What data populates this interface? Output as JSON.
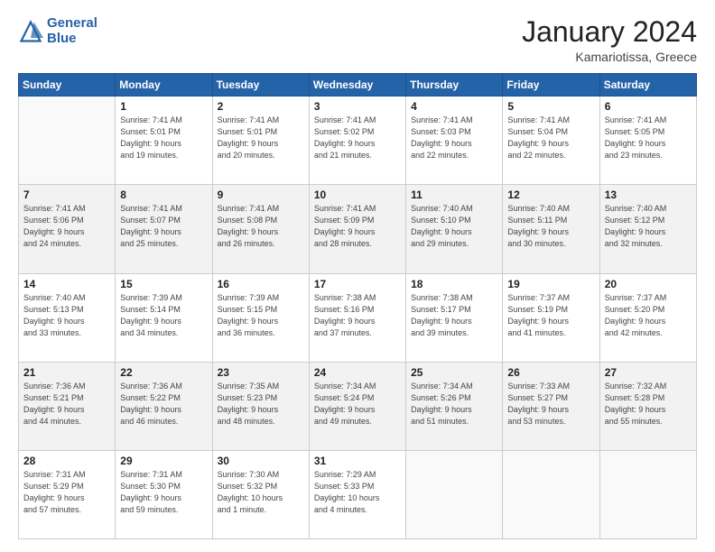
{
  "header": {
    "logo_line1": "General",
    "logo_line2": "Blue",
    "month": "January 2024",
    "location": "Kamariotissa, Greece"
  },
  "weekdays": [
    "Sunday",
    "Monday",
    "Tuesday",
    "Wednesday",
    "Thursday",
    "Friday",
    "Saturday"
  ],
  "weeks": [
    [
      {
        "day": "",
        "info": ""
      },
      {
        "day": "1",
        "info": "Sunrise: 7:41 AM\nSunset: 5:01 PM\nDaylight: 9 hours\nand 19 minutes."
      },
      {
        "day": "2",
        "info": "Sunrise: 7:41 AM\nSunset: 5:01 PM\nDaylight: 9 hours\nand 20 minutes."
      },
      {
        "day": "3",
        "info": "Sunrise: 7:41 AM\nSunset: 5:02 PM\nDaylight: 9 hours\nand 21 minutes."
      },
      {
        "day": "4",
        "info": "Sunrise: 7:41 AM\nSunset: 5:03 PM\nDaylight: 9 hours\nand 22 minutes."
      },
      {
        "day": "5",
        "info": "Sunrise: 7:41 AM\nSunset: 5:04 PM\nDaylight: 9 hours\nand 22 minutes."
      },
      {
        "day": "6",
        "info": "Sunrise: 7:41 AM\nSunset: 5:05 PM\nDaylight: 9 hours\nand 23 minutes."
      }
    ],
    [
      {
        "day": "7",
        "info": "Sunrise: 7:41 AM\nSunset: 5:06 PM\nDaylight: 9 hours\nand 24 minutes."
      },
      {
        "day": "8",
        "info": "Sunrise: 7:41 AM\nSunset: 5:07 PM\nDaylight: 9 hours\nand 25 minutes."
      },
      {
        "day": "9",
        "info": "Sunrise: 7:41 AM\nSunset: 5:08 PM\nDaylight: 9 hours\nand 26 minutes."
      },
      {
        "day": "10",
        "info": "Sunrise: 7:41 AM\nSunset: 5:09 PM\nDaylight: 9 hours\nand 28 minutes."
      },
      {
        "day": "11",
        "info": "Sunrise: 7:40 AM\nSunset: 5:10 PM\nDaylight: 9 hours\nand 29 minutes."
      },
      {
        "day": "12",
        "info": "Sunrise: 7:40 AM\nSunset: 5:11 PM\nDaylight: 9 hours\nand 30 minutes."
      },
      {
        "day": "13",
        "info": "Sunrise: 7:40 AM\nSunset: 5:12 PM\nDaylight: 9 hours\nand 32 minutes."
      }
    ],
    [
      {
        "day": "14",
        "info": "Sunrise: 7:40 AM\nSunset: 5:13 PM\nDaylight: 9 hours\nand 33 minutes."
      },
      {
        "day": "15",
        "info": "Sunrise: 7:39 AM\nSunset: 5:14 PM\nDaylight: 9 hours\nand 34 minutes."
      },
      {
        "day": "16",
        "info": "Sunrise: 7:39 AM\nSunset: 5:15 PM\nDaylight: 9 hours\nand 36 minutes."
      },
      {
        "day": "17",
        "info": "Sunrise: 7:38 AM\nSunset: 5:16 PM\nDaylight: 9 hours\nand 37 minutes."
      },
      {
        "day": "18",
        "info": "Sunrise: 7:38 AM\nSunset: 5:17 PM\nDaylight: 9 hours\nand 39 minutes."
      },
      {
        "day": "19",
        "info": "Sunrise: 7:37 AM\nSunset: 5:19 PM\nDaylight: 9 hours\nand 41 minutes."
      },
      {
        "day": "20",
        "info": "Sunrise: 7:37 AM\nSunset: 5:20 PM\nDaylight: 9 hours\nand 42 minutes."
      }
    ],
    [
      {
        "day": "21",
        "info": "Sunrise: 7:36 AM\nSunset: 5:21 PM\nDaylight: 9 hours\nand 44 minutes."
      },
      {
        "day": "22",
        "info": "Sunrise: 7:36 AM\nSunset: 5:22 PM\nDaylight: 9 hours\nand 46 minutes."
      },
      {
        "day": "23",
        "info": "Sunrise: 7:35 AM\nSunset: 5:23 PM\nDaylight: 9 hours\nand 48 minutes."
      },
      {
        "day": "24",
        "info": "Sunrise: 7:34 AM\nSunset: 5:24 PM\nDaylight: 9 hours\nand 49 minutes."
      },
      {
        "day": "25",
        "info": "Sunrise: 7:34 AM\nSunset: 5:26 PM\nDaylight: 9 hours\nand 51 minutes."
      },
      {
        "day": "26",
        "info": "Sunrise: 7:33 AM\nSunset: 5:27 PM\nDaylight: 9 hours\nand 53 minutes."
      },
      {
        "day": "27",
        "info": "Sunrise: 7:32 AM\nSunset: 5:28 PM\nDaylight: 9 hours\nand 55 minutes."
      }
    ],
    [
      {
        "day": "28",
        "info": "Sunrise: 7:31 AM\nSunset: 5:29 PM\nDaylight: 9 hours\nand 57 minutes."
      },
      {
        "day": "29",
        "info": "Sunrise: 7:31 AM\nSunset: 5:30 PM\nDaylight: 9 hours\nand 59 minutes."
      },
      {
        "day": "30",
        "info": "Sunrise: 7:30 AM\nSunset: 5:32 PM\nDaylight: 10 hours\nand 1 minute."
      },
      {
        "day": "31",
        "info": "Sunrise: 7:29 AM\nSunset: 5:33 PM\nDaylight: 10 hours\nand 4 minutes."
      },
      {
        "day": "",
        "info": ""
      },
      {
        "day": "",
        "info": ""
      },
      {
        "day": "",
        "info": ""
      }
    ]
  ]
}
